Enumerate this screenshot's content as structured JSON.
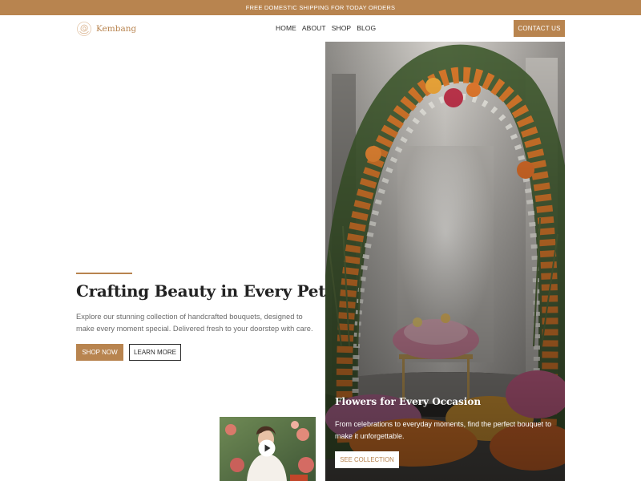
{
  "promo": {
    "text": "FREE DOMESTIC SHIPPING FOR TODAY ORDERS"
  },
  "brand": {
    "name": "Kembang",
    "logo_icon": "rose-logo-icon"
  },
  "nav": {
    "links": [
      "HOME",
      "ABOUT",
      "SHOP",
      "BLOG"
    ],
    "contact_label": "CONTACT US"
  },
  "hero": {
    "title": "Crafting Beauty in Every Petal",
    "description": "Explore our stunning collection of handcrafted bouquets, designed to make every moment special. Delivered fresh to your doorstep with care.",
    "shop_label": "SHOP NOW",
    "learn_label": "LEARN MORE"
  },
  "video": {
    "play_icon": "play-icon"
  },
  "feature": {
    "title": "Flowers for Every Occasion",
    "description": "From celebrations to everyday moments, find the perfect bouquet to make it unforgettable.",
    "button_label": "SEE COLLECTION"
  },
  "colors": {
    "accent": "#b8844f",
    "text": "#2b2b2b",
    "muted": "#6b6b6b"
  }
}
